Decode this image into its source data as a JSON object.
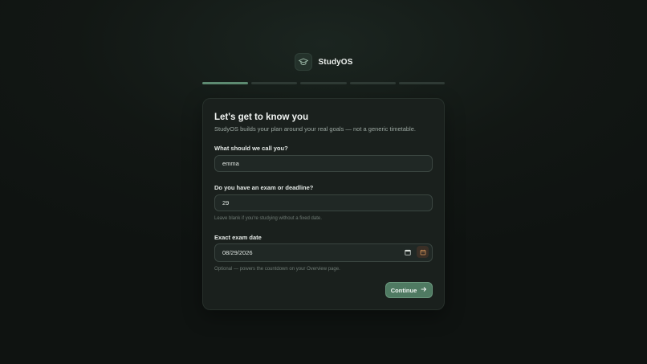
{
  "brand": {
    "name": "StudyOS",
    "logo_icon": "graduation-cap-icon"
  },
  "progress": {
    "total_steps": 5,
    "current_step": 1
  },
  "card": {
    "title": "Let's get to know you",
    "subtitle": "StudyOS builds your plan around your real goals — not a generic timetable."
  },
  "fields": {
    "name": {
      "label": "What should we call you?",
      "value": "emma"
    },
    "deadline": {
      "label": "Do you have an exam or deadline?",
      "value": "29",
      "hint": "Leave blank if you're studying without a fixed date."
    },
    "exam_date": {
      "label": "Exact exam date",
      "value": "08/29/2026",
      "hint": "Optional — powers the countdown on your Overview page.",
      "icons": [
        "calendar-icon",
        "calendar-accent-icon"
      ]
    }
  },
  "actions": {
    "continue_label": "Continue",
    "continue_icon": "arrow-right-icon"
  },
  "colors": {
    "accent": "#5d8a71",
    "button": "#4f7a62",
    "background": "#121714",
    "card": "#1a201d"
  }
}
